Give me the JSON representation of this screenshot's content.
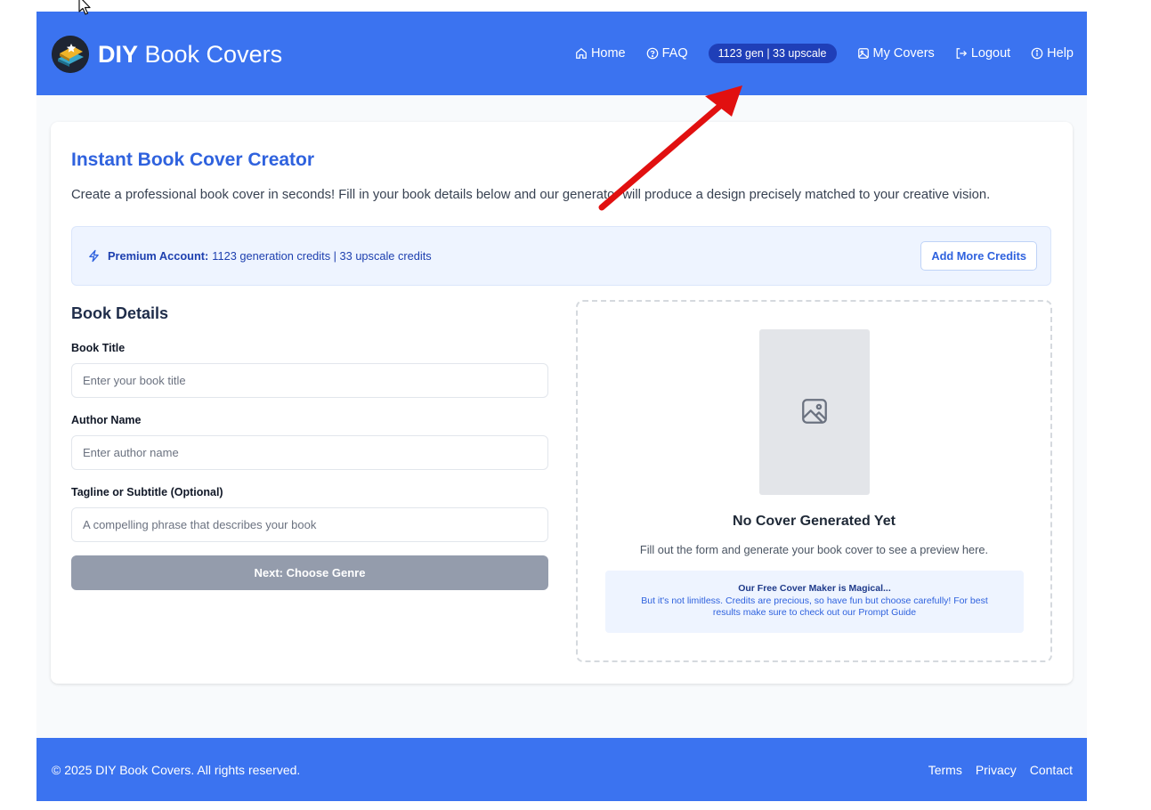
{
  "header": {
    "brand_bold": "DIY",
    "brand_rest": " Book Covers",
    "nav": {
      "home": "Home",
      "faq": "FAQ",
      "credits": "1123 gen | 33 upscale",
      "my_covers": "My Covers",
      "logout": "Logout",
      "help": "Help"
    }
  },
  "main": {
    "title": "Instant Book Cover Creator",
    "description": "Create a professional book cover in seconds! Fill in your book details below and our generator will produce a design precisely matched to your creative vision.",
    "premium": {
      "label": "Premium Account:",
      "text": "1123 generation credits | 33 upscale credits",
      "button": "Add More Credits"
    },
    "form": {
      "heading": "Book Details",
      "title_label": "Book Title",
      "title_placeholder": "Enter your book title",
      "author_label": "Author Name",
      "author_placeholder": "Enter author name",
      "tagline_label": "Tagline or Subtitle (Optional)",
      "tagline_placeholder": "A compelling phrase that describes your book",
      "next_button": "Next: Choose Genre"
    },
    "preview": {
      "title": "No Cover Generated Yet",
      "subtitle": "Fill out the form and generate your book cover to see a preview here.",
      "notice_title": "Our Free Cover Maker is Magical...",
      "notice_body": "But it's not limitless. Credits are precious, so have fun but choose carefully! For best results make sure to check out our Prompt Guide"
    }
  },
  "footer": {
    "copyright": "© 2025 DIY Book Covers. All rights reserved.",
    "links": [
      "Terms",
      "Privacy",
      "Contact"
    ]
  },
  "icons": [
    "home-icon",
    "faq-icon",
    "image-icon",
    "logout-icon",
    "help-icon",
    "lightning-icon",
    "image-placeholder-icon",
    "cursor-icon"
  ],
  "colors": {
    "brand_blue": "#3b73f0",
    "credit_pill": "#1f3fb8",
    "accent_text": "#2f62de",
    "annotation_arrow": "#e11010"
  }
}
